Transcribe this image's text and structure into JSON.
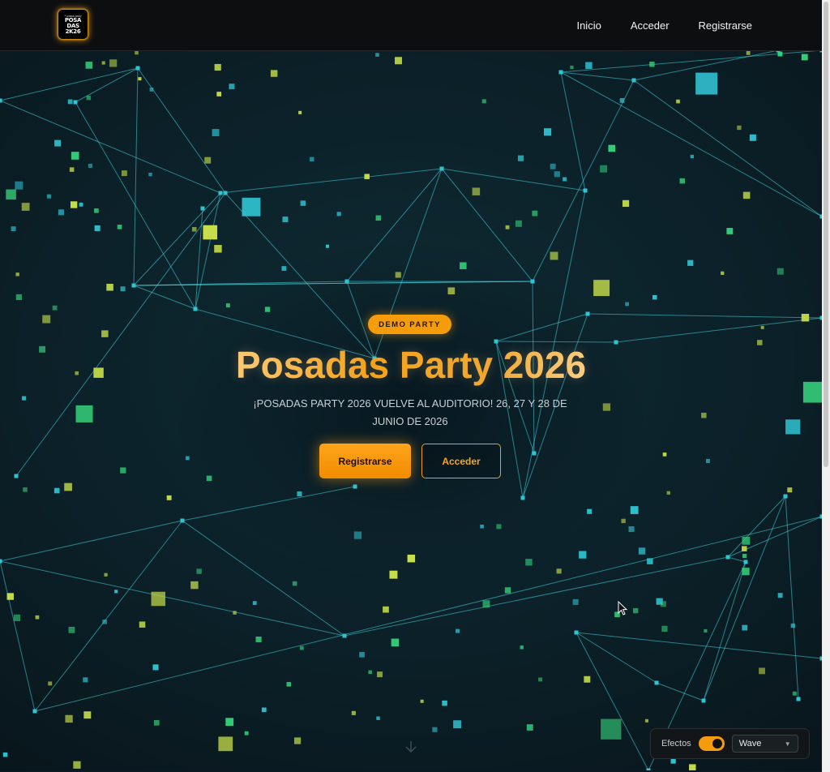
{
  "logo": {
    "lines": [
      "POSA",
      "DAS",
      "2K26"
    ],
    "tagline": "* unique party"
  },
  "nav": {
    "items": [
      "Inicio",
      "Acceder",
      "Registrarse"
    ]
  },
  "hero": {
    "badge": "DEMO PARTY",
    "title": "Posadas Party 2026",
    "subtitle": "¡POSADAS PARTY 2026 VUELVE AL AUDITORIO! 26, 27 Y 28 DE JUNIO DE 2026",
    "primary_button": "Registrarse",
    "secondary_button": "Acceder"
  },
  "effects": {
    "label": "Efectos",
    "enabled": true,
    "mode": "Wave"
  },
  "colors": {
    "accent": "#f59c0c",
    "line": "#3fd6de",
    "square_cyan": "#2fc4d2",
    "square_lime": "#c9e04a",
    "square_green": "#35d07a",
    "background": "#0b1f27"
  },
  "icons": {
    "scroll": "arrow-down-icon",
    "select": "chevron-down-icon",
    "pointer": "mouse-pointer-icon"
  }
}
